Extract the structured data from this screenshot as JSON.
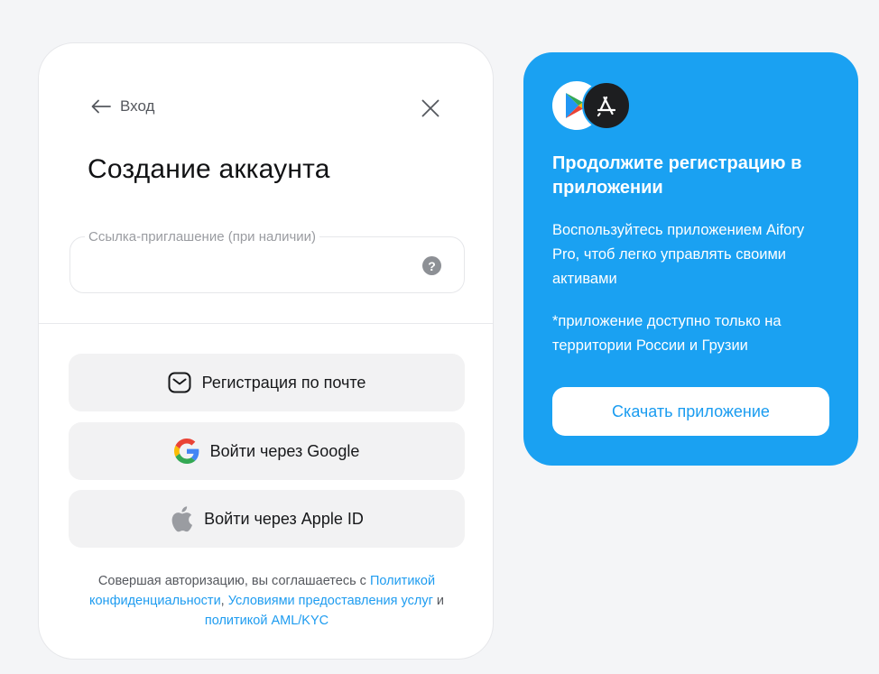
{
  "login_card": {
    "back_label": "Вход",
    "title": "Создание аккаунта",
    "invite_field": {
      "label": "Ссылка-приглашение (при наличии)",
      "value": "",
      "help_symbol": "?"
    },
    "buttons": {
      "email": "Регистрация по почте",
      "google": "Войти через Google",
      "apple": "Войти через Apple ID"
    },
    "legal": {
      "prefix": "Совершая авторизацию, вы соглашаетесь с ",
      "privacy_link": "Политикой конфиденциальности",
      "separator": ", ",
      "terms_link": "Условиями предоставления услуг",
      "and": " и ",
      "aml_link": "политикой AML/KYC"
    }
  },
  "promo_card": {
    "title": "Продолжите регистрацию в приложении",
    "description": "Воспользуйтесь приложением Aifory Pro, чтоб легко управлять своими активами",
    "note": "*приложение доступно только на территории России и Грузии",
    "download_label": "Скачать приложение",
    "icons": [
      "google-play-icon",
      "app-store-icon"
    ]
  },
  "colors": {
    "accent": "#1aa1f2",
    "link": "#1e9cf0",
    "button_bg": "#f2f2f3",
    "page_bg": "#f4f5f7"
  }
}
